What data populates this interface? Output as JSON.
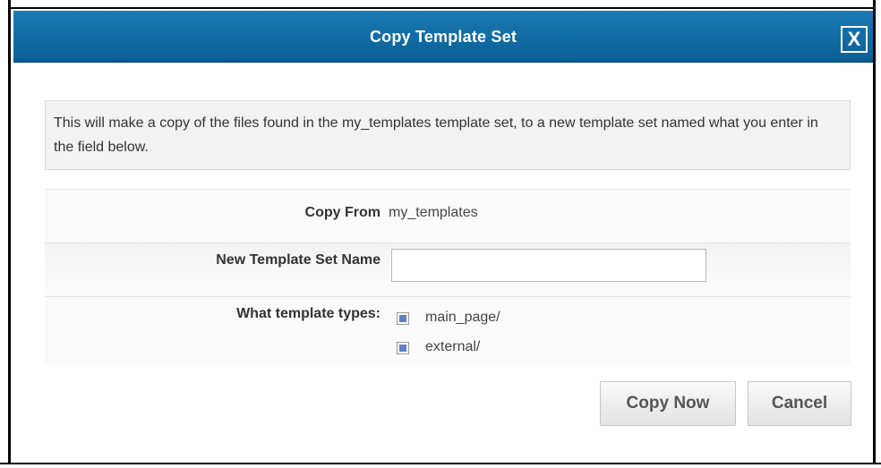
{
  "dialog": {
    "title": "Copy Template Set",
    "close_label": "X"
  },
  "info": {
    "text": "This will make a copy of the files found in the my_templates template set, to a new template set named what you enter in the field below."
  },
  "form": {
    "copy_from_label": "Copy From",
    "copy_from_value": "my_templates",
    "new_name_label": "New Template Set Name",
    "new_name_value": "",
    "types_label": "What template types:",
    "types": [
      {
        "label": "main_page/",
        "checked": true
      },
      {
        "label": "external/",
        "checked": true
      }
    ]
  },
  "buttons": {
    "copy_now": "Copy Now",
    "cancel": "Cancel"
  },
  "colors": {
    "titlebar": "#0a6aa3",
    "checkbox_fill": "#5e7fc4"
  }
}
